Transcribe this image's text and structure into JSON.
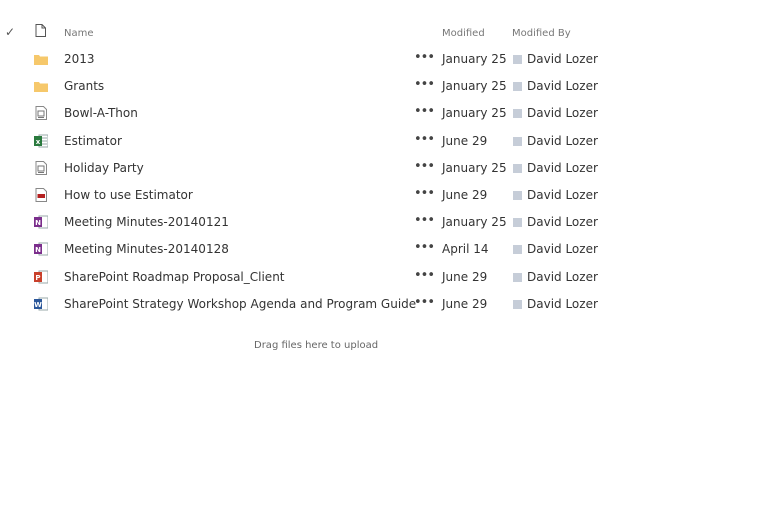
{
  "header": {
    "check_glyph": "✓",
    "col_name": "Name",
    "col_modified": "Modified",
    "col_modified_by": "Modified By"
  },
  "rows": [
    {
      "name": "2013",
      "modified": "January 25",
      "modified_by": "David Lozer",
      "type": "folder"
    },
    {
      "name": "Grants",
      "modified": "January 25",
      "modified_by": "David Lozer",
      "type": "folder"
    },
    {
      "name": "Bowl-A-Thon",
      "modified": "January 25",
      "modified_by": "David Lozer",
      "type": "generic"
    },
    {
      "name": "Estimator",
      "modified": "June 29",
      "modified_by": "David Lozer",
      "type": "excel"
    },
    {
      "name": "Holiday Party",
      "modified": "January 25",
      "modified_by": "David Lozer",
      "type": "generic"
    },
    {
      "name": "How to use Estimator",
      "modified": "June 29",
      "modified_by": "David Lozer",
      "type": "pdf"
    },
    {
      "name": "Meeting Minutes-20140121",
      "modified": "January 25",
      "modified_by": "David Lozer",
      "type": "onenote"
    },
    {
      "name": "Meeting Minutes-20140128",
      "modified": "April 14",
      "modified_by": "David Lozer",
      "type": "onenote"
    },
    {
      "name": "SharePoint Roadmap Proposal_Client",
      "modified": "June 29",
      "modified_by": "David Lozer",
      "type": "powerpoint"
    },
    {
      "name": "SharePoint Strategy Workshop Agenda and Program Guide",
      "modified": "June 29",
      "modified_by": "David Lozer",
      "type": "word"
    }
  ],
  "more_glyph": "•••",
  "upload_hint": "Drag files here to upload",
  "colors": {
    "folder": "#f6c86b",
    "excel": "#2a7a3e",
    "onenote": "#7b2e8c",
    "powerpoint": "#c9402b",
    "word": "#2b579a",
    "pdf": "#b52020",
    "presence": "#c6cdd8"
  }
}
